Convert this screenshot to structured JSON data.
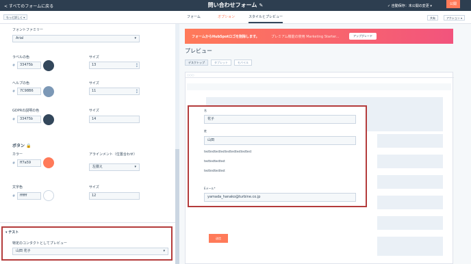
{
  "topbar": {
    "back_label": "< すべてのフォームに戻る",
    "title": "問い合わせフォーム",
    "autosave": "✓ 自動保存：未公開の変更 ▾",
    "publish_label": "公開"
  },
  "tabs": {
    "more_label": "もっと詳しく ▾",
    "form": "フォーム",
    "options": "オプション",
    "style_preview": "スタイルとプレビュー",
    "share_label": "共有",
    "actions_label": "アクション ▾"
  },
  "left": {
    "font_family_label": "フォントファミリー",
    "font_family_value": "Arial",
    "label_color_label": "ラベルの色",
    "label_color_value": "33475b",
    "label_size_label": "サイズ",
    "label_size_value": "13",
    "help_color_label": "ヘルプの色",
    "help_color_value": "7C98B6",
    "help_size_label": "サイズ",
    "help_size_value": "11",
    "gdpr_color_label": "GDPRの説明の色",
    "gdpr_color_value": "33475b",
    "gdpr_size_label": "サイズ",
    "gdpr_size_value": "14",
    "button_section": "ボタン 🔒",
    "button_color_label": "カラー",
    "button_color_value": "ff7a59",
    "align_label": "アラインメント（位置合わせ）",
    "align_value": "左揃え",
    "text_color_label": "文字色",
    "text_color_value": "ffffff",
    "text_size_label": "サイズ",
    "text_size_value": "12",
    "test_section": "テスト",
    "test_preview_label": "特定のコンタクトとしてプレビュー",
    "test_contact_value": "山田 花子",
    "hash": "#"
  },
  "right": {
    "banner_text": "フォームからHubSpotロゴを削除します。",
    "banner_sub": "プレミアム機能の使用 Marketing Starter...",
    "upgrade_label": "アップグレード",
    "preview_title": "プレビュー",
    "device_tabs": [
      "デスクトップ",
      "タブレット",
      "モバイル"
    ],
    "frame_dots": "○○○"
  },
  "form": {
    "first_name_label": "名",
    "first_name_value": "花子",
    "last_name_label": "姓",
    "last_name_value": "山田",
    "text1": "testtesttesttesttesttesttesttesttest",
    "text2": "testtesttesttest",
    "text3": "testtesttesttest",
    "email_label": "Eメール*",
    "email_value": "yamada_hanako@turbine.co.jp",
    "submit_label": "送信"
  },
  "colors": {
    "label_swatch": "#33475b",
    "help_swatch": "#7c98b6",
    "gdpr_swatch": "#33475b",
    "button_swatch": "#ff7a59",
    "text_swatch": "#ffffff",
    "accent": "#ff7a59",
    "highlight": "#b33a3a"
  }
}
